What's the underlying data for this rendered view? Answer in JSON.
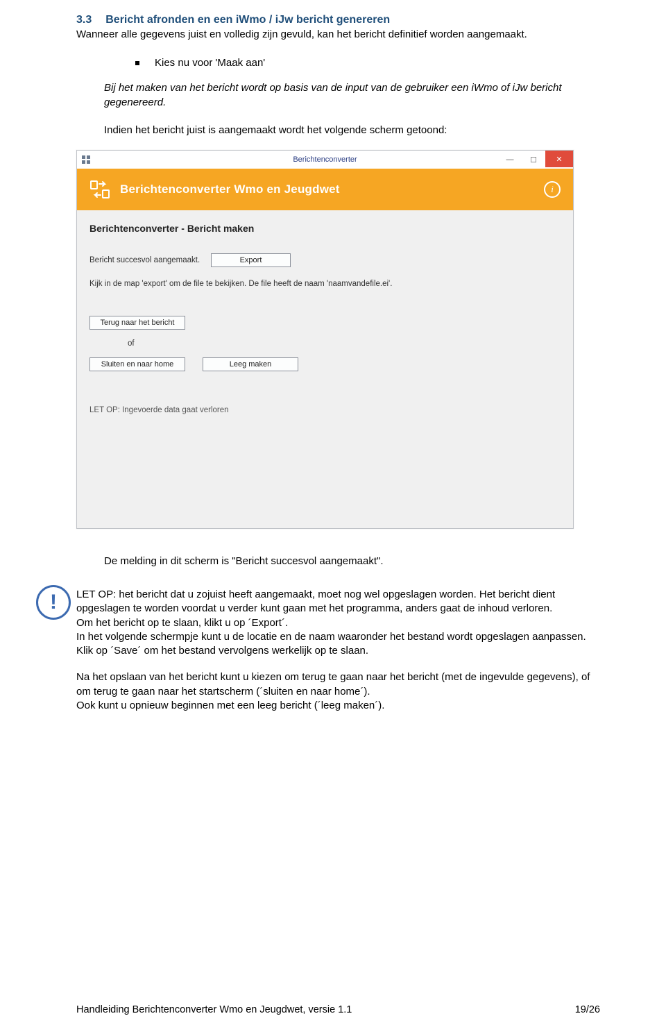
{
  "section": {
    "number": "3.3",
    "title": "Bericht afronden en een iWmo / iJw bericht genereren",
    "intro": "Wanneer alle gegevens juist en volledig zijn gevuld, kan het bericht definitief worden aangemaakt.",
    "bullet": "Kies nu voor 'Maak aan'",
    "italic1": "Bij het maken van het bericht wordt op basis van de input van de gebruiker een iWmo of iJw bericht gegenereerd.",
    "pre_screenshot": "Indien het bericht juist is aangemaakt wordt het volgende scherm getoond:"
  },
  "app": {
    "window_title": "Berichtenconverter",
    "header_title": "Berichtenconverter Wmo en Jeugdwet",
    "subtitle": "Berichtenconverter - Bericht maken",
    "success_label": "Bericht succesvol aangemaakt.",
    "export_btn": "Export",
    "hint": "Kijk in de map 'export' om de file te bekijken. De file heeft de naam 'naamvandefile.ei'.",
    "back_btn": "Terug naar het bericht",
    "of_label": "of",
    "close_home_btn": "Sluiten en naar home",
    "clear_btn": "Leeg maken",
    "warn": "LET OP: Ingevoerde data gaat verloren"
  },
  "caption": "De melding in dit scherm is \"Bericht succesvol aangemaakt\".",
  "note": {
    "p1": "LET OP: het bericht dat u zojuist heeft aangemaakt, moet nog wel opgeslagen worden. Het bericht dient opgeslagen te worden voordat u verder kunt gaan met het programma, anders gaat de inhoud verloren.",
    "p2": "Om het bericht op te slaan, klikt u op ´Export´.",
    "p3": "In het volgende schermpje kunt u de locatie en de naam waaronder het bestand wordt opgeslagen aanpassen. Klik op ´Save´ om het bestand vervolgens werkelijk op te slaan.",
    "p4": "Na het opslaan van het bericht kunt u kiezen om terug te gaan naar het bericht (met de ingevulde gegevens), of om terug te gaan naar het startscherm (´sluiten en naar home´).",
    "p5": "Ook kunt u opnieuw beginnen met een leeg bericht (´leeg maken´)."
  },
  "footer": {
    "left": "Handleiding Berichtenconverter Wmo en Jeugdwet, versie 1.1",
    "right": "19/26"
  }
}
